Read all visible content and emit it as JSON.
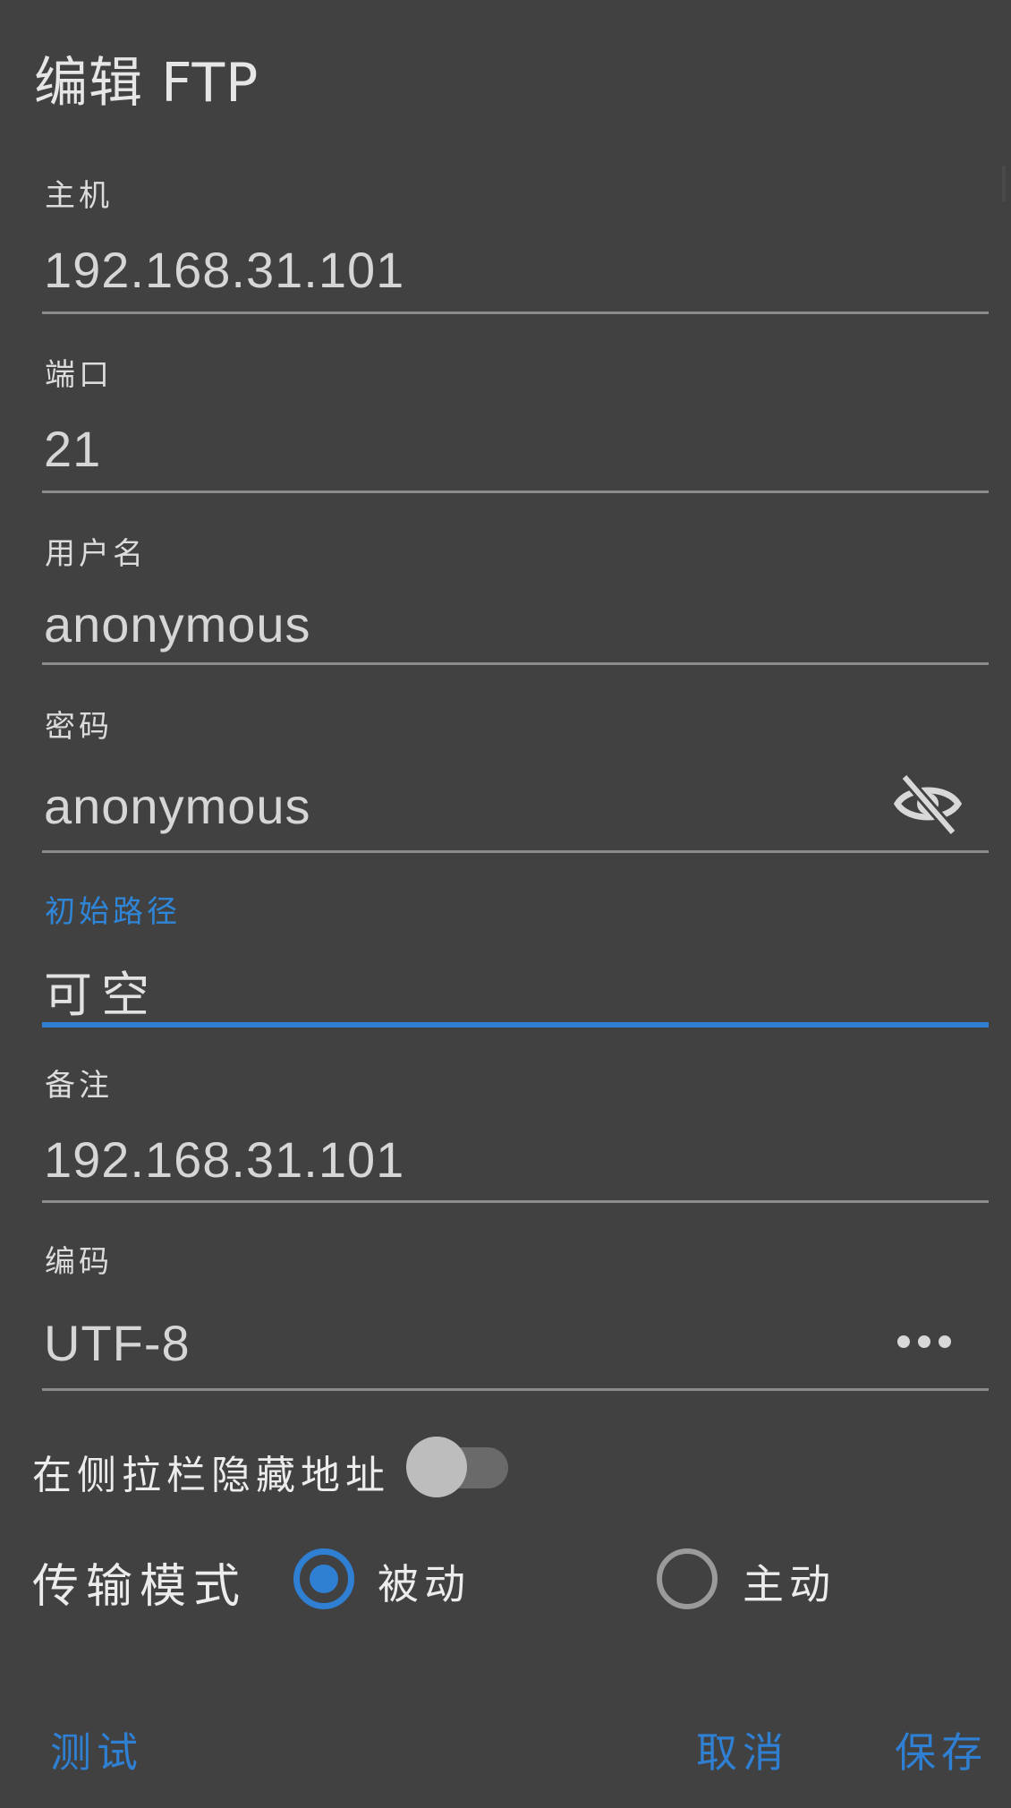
{
  "dialog": {
    "title": "编辑 FTP"
  },
  "fields": {
    "host": {
      "label": "主机",
      "value": "192.168.31.101"
    },
    "port": {
      "label": "端口",
      "value": "21"
    },
    "username": {
      "label": "用户名",
      "value": "anonymous"
    },
    "password": {
      "label": "密码",
      "value": "anonymous",
      "toggle_icon": "eye-off-icon"
    },
    "initial_path": {
      "label": "初始路径",
      "placeholder": "可空",
      "focused": true
    },
    "note": {
      "label": "备注",
      "value": "192.168.31.101"
    },
    "encoding": {
      "label": "编码",
      "value": "UTF-8",
      "more_icon": "more-horizontal-icon"
    }
  },
  "sidebar_toggle": {
    "label": "在侧拉栏隐藏地址",
    "checked": false
  },
  "transfer_mode": {
    "label": "传输模式",
    "options": [
      {
        "label": "被动",
        "checked": true
      },
      {
        "label": "主动",
        "checked": false
      }
    ]
  },
  "actions": {
    "test": "测试",
    "cancel": "取消",
    "save": "保存"
  },
  "colors": {
    "background": "#414141",
    "accent": "#2f7fd3",
    "text": "#e8e8e8",
    "divider": "#8c8c8c"
  }
}
